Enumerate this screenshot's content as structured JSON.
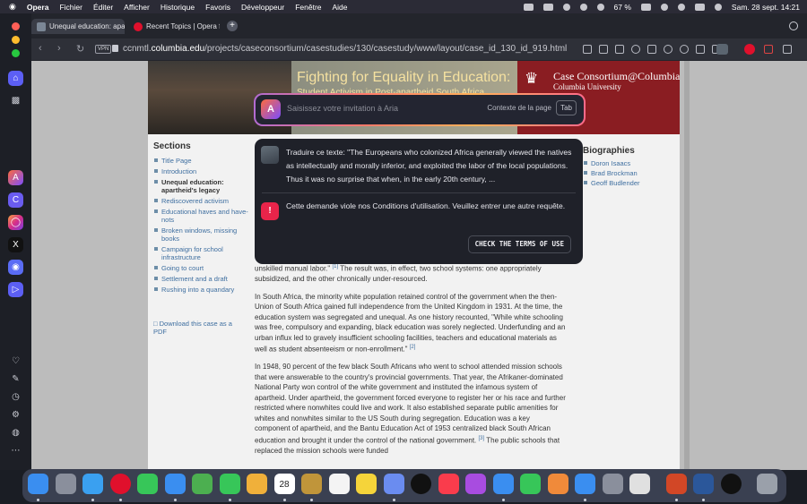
{
  "menubar": {
    "apple": "",
    "app": "Opera",
    "items": [
      "Fichier",
      "Éditer",
      "Afficher",
      "Historique",
      "Favoris",
      "Développeur",
      "Fenêtre",
      "Aide"
    ],
    "battery": "67 %",
    "datetime": "Sam. 28 sept.  14:21"
  },
  "tabs": [
    {
      "title": "Unequal education: apa",
      "active": true
    },
    {
      "title": "Recent Topics | Opera fo",
      "active": false
    }
  ],
  "addressbar": {
    "vpn": "VPN",
    "url_pre": "ccnmtl.",
    "url_domain": "columbia.edu",
    "url_post": "/projects/caseconsortium/casestudies/130/casestudy/www/layout/case_id_130_id_919.html"
  },
  "page": {
    "banner": {
      "title": "Fighting for Equality in Education:",
      "subtitle": "Student Activism in Post-apartheid South Africa",
      "org": "Case Consortium@Columbia",
      "org_sub": "Columbia University"
    },
    "sections_title": "Sections",
    "sections": [
      {
        "label": "Title Page"
      },
      {
        "label": "Introduction"
      },
      {
        "label": "Unequal education: apartheid's legacy",
        "current": true
      },
      {
        "label": "Rediscovered activism"
      },
      {
        "label": "Educational haves and have-nots"
      },
      {
        "label": "Broken windows, missing books"
      },
      {
        "label": "Campaign for school infrastructure"
      },
      {
        "label": "Going to court"
      },
      {
        "label": "Settlement and a draft"
      },
      {
        "label": "Rushing into a quandary"
      }
    ],
    "download": "Download this case as a PDF",
    "biographies_title": "Biographies",
    "biographies": [
      "Doron Isaacs",
      "Brad Brockman",
      "Geoff Budlender"
    ],
    "p1a": "unskilled manual labor.\"",
    "p1ref": "[1]",
    "p1b": " The result was, in effect, two school systems: one appropriately subsidized, and the other chronically under-resourced.",
    "p2a": "In South Africa, the minority white population retained control of the government when the then-Union of South Africa gained full independence from the United Kingdom in 1931. At the time, the education system was segregated and unequal. As one history recounted, \"While white schooling was free, compulsory and expanding, black education was sorely neglected. Underfunding and an urban influx led to gravely insufficient schooling facilities, teachers and educational materials as well as student absenteeism or non-enrollment.\"",
    "p2ref": "[2]",
    "p3a": "In 1948, 90 percent of the few black South Africans who went to school attended mission schools that were answerable to the country's provincial governments. That year, the Afrikaner-dominated National Party won control of the white government and instituted the infamous system of apartheid. Under apartheid, the government forced everyone to register her or his race and further restricted where nonwhites could live and work. It also established separate public amenities for whites and nonwhites similar to the US South during segregation. Education was a key component of apartheid, and the Bantu Education Act of 1953 centralized black South African education and brought it under the control of the national government.",
    "p3ref": "[3]",
    "p3b": " The public schools that replaced the mission schools were funded"
  },
  "aria": {
    "placeholder": "Saisissez votre invitation à Aria",
    "context": "Contexte de la page",
    "tab_key": "Tab",
    "prompt": "Traduire ce texte: \"The Europeans who colonized Africa generally viewed the natives as intellectually and morally inferior, and exploited the labor of the local populations. Thus it was no surprise that when, in the early 20th century, ...",
    "warning_icon": "!",
    "warning": "Cette demande viole nos Conditions d'utilisation. Veuillez entrer une autre requête.",
    "terms_button": "CHECK THE TERMS OF USE"
  },
  "colors": {
    "aria_gradient": [
      "#b26bd1",
      "#ff7a6a",
      "#ffb259"
    ],
    "warning": "#e8244a",
    "link": "#3f6fa0",
    "banner": "#8a1d22"
  },
  "dock_apps": [
    "Finder",
    "Launchpad",
    "Safari",
    "Opera",
    "Messages",
    "Mail",
    "Maps",
    "FaceTime",
    "Photos",
    "Calendar",
    "Keynote",
    "Reminders",
    "Notes",
    "Freeform",
    "TV",
    "Music",
    "Podcasts",
    "Keynote",
    "Numbers",
    "Pages",
    "App Store",
    "System Settings",
    "Roblox",
    "PowerPoint",
    "Word",
    "Typora",
    "Trash"
  ],
  "calendar": {
    "month": "SEPT.",
    "day": "28"
  }
}
